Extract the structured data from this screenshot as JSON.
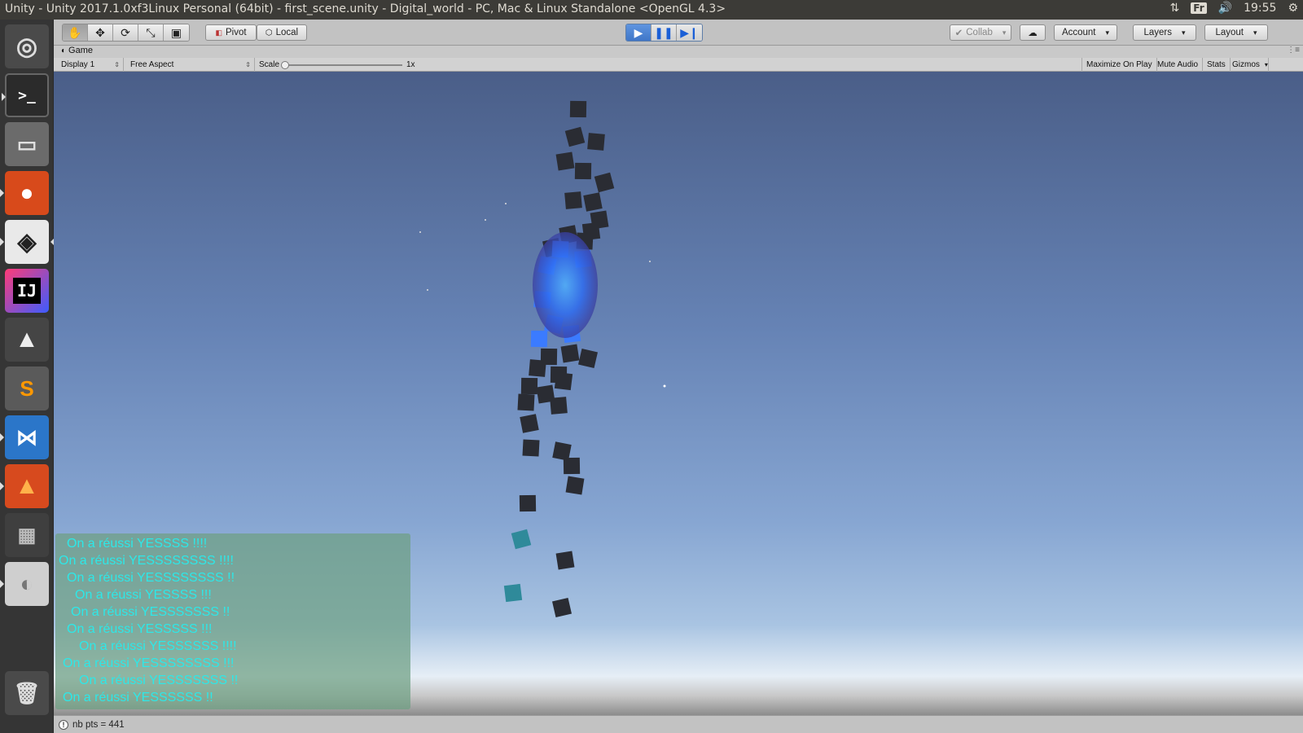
{
  "window": {
    "title": "Unity - Unity 2017.1.0xf3Linux Personal (64bit) - first_scene.unity - Digital_world - PC, Mac & Linux Standalone <OpenGL 4.3>"
  },
  "tray": {
    "keyboard": "Fr",
    "time": "19:55"
  },
  "launcher": {
    "items": [
      {
        "name": "ubuntu-dash",
        "glyph": "◎"
      },
      {
        "name": "terminal",
        "glyph": ">_"
      },
      {
        "name": "files",
        "glyph": "▭"
      },
      {
        "name": "firefox",
        "glyph": "🦊"
      },
      {
        "name": "unity",
        "glyph": "◈"
      },
      {
        "name": "intellij",
        "glyph": "IJ"
      },
      {
        "name": "inkscape",
        "glyph": "▲"
      },
      {
        "name": "sublime-text",
        "glyph": "S"
      },
      {
        "name": "vscode",
        "glyph": "⋈"
      },
      {
        "name": "matlab",
        "glyph": "▲"
      },
      {
        "name": "workspace-switcher",
        "glyph": "▦"
      },
      {
        "name": "disk",
        "glyph": "◐"
      },
      {
        "name": "trash",
        "glyph": "🗑"
      }
    ]
  },
  "toolbar": {
    "pivot_label": "Pivot",
    "local_label": "Local",
    "collab_label": "Collab",
    "account_label": "Account",
    "layers_label": "Layers",
    "layout_label": "Layout"
  },
  "game_panel": {
    "tab_label": "Game",
    "display_label": "Display 1",
    "aspect_label": "Free Aspect",
    "scale_label": "Scale",
    "scale_value": "1x",
    "maximize_label": "Maximize On Play",
    "mute_label": "Mute Audio",
    "stats_label": "Stats",
    "gizmos_label": "Gizmos"
  },
  "log": {
    "lines": [
      "On a réussi YESSSS !!!!",
      "On a réussi YESSSSSSSS !!!!",
      "On a réussi YESSSSSSSS !!",
      "On a réussi YESSSS !!!",
      "On a réussi YESSSSSSS !!",
      "On a réussi YESSSSS !!!",
      "On a réussi YESSSSSS !!!!",
      "On a réussi YESSSSSSSS !!!",
      "On a réussi YESSSSSSS !!",
      "On a réussi YESSSSSS !!"
    ]
  },
  "status": {
    "message": "nb pts = 441"
  },
  "colors": {
    "log_text": "#2de8e8",
    "play_active": "#3f76c8",
    "cube_dark": "#2a2c33",
    "cube_blue": "#3b7bff"
  }
}
